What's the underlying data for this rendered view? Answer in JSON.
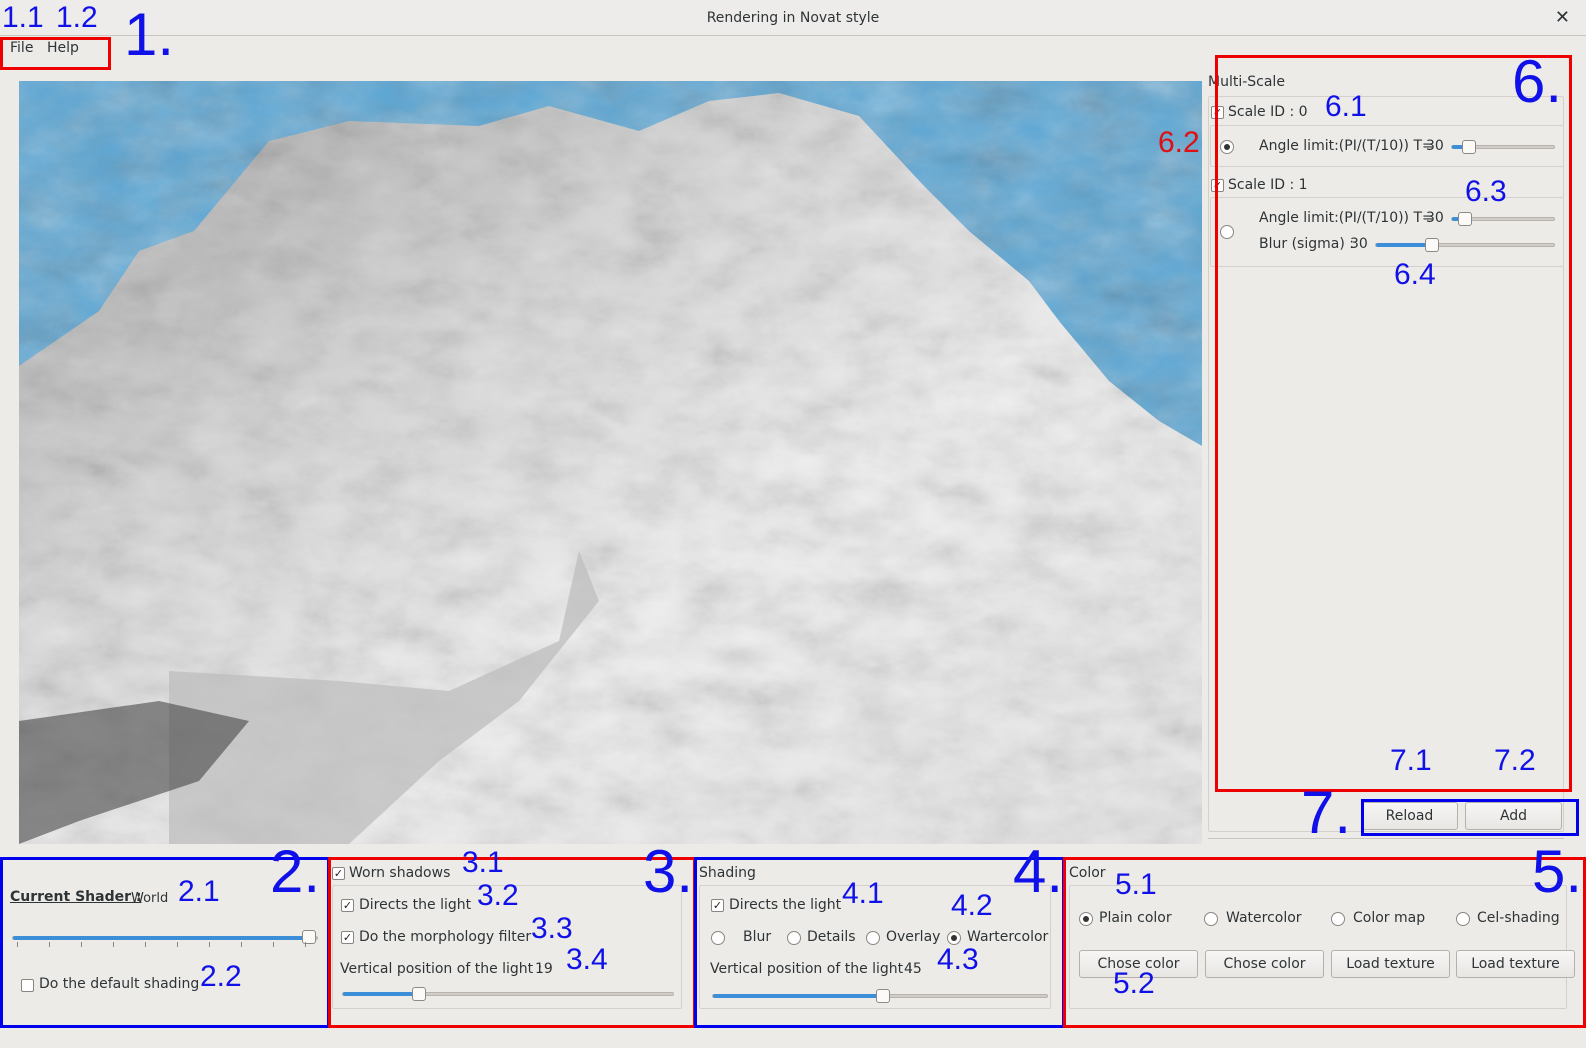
{
  "window": {
    "title": "Rendering in Novat style",
    "close": "✕"
  },
  "menu": {
    "file": "File",
    "help": "Help"
  },
  "multiscale": {
    "title": "Multi-Scale",
    "scale0": {
      "label": "Scale ID : 0",
      "checked": true,
      "angle_label": "Angle limit:(PI/(T/10)) T=",
      "angle_value": "30",
      "radio": true
    },
    "scale1": {
      "label": "Scale ID : 1",
      "checked": true,
      "angle_label": "Angle limit:(PI/(T/10)) T=",
      "angle_value": "30",
      "blur_label": "Blur (sigma) :",
      "blur_value": "30",
      "radio": false
    }
  },
  "buttons": {
    "reload": "Reload",
    "add": "Add"
  },
  "shader": {
    "label": "Current Shader :",
    "value": "World",
    "default_shading": "Do the default shading",
    "default_checked": false,
    "slider_level": 1.0
  },
  "worn": {
    "title": "Worn shadows",
    "checked": true,
    "directs": "Directs the light",
    "directs_checked": true,
    "morph": "Do the morphology filter",
    "morph_checked": true,
    "vpos_label": "Vertical position of the light :",
    "vpos_value": "19"
  },
  "shading": {
    "title": "Shading",
    "directs": "Directs the light",
    "directs_checked": true,
    "options": [
      "Blur",
      "Details",
      "Overlay",
      "Wartercolor"
    ],
    "selected": "Wartercolor",
    "vpos_label": "Vertical position of the light :",
    "vpos_value": "45"
  },
  "color": {
    "title": "Color",
    "options": [
      "Plain color",
      "Watercolor",
      "Color map",
      "Cel-shading"
    ],
    "selected": "Plain color",
    "buttons": [
      "Chose color",
      "Chose color",
      "Load texture",
      "Load texture"
    ]
  },
  "annotations": {
    "a1": "1.",
    "a11": "1.1",
    "a12": "1.2",
    "a2": "2.",
    "a21": "2.1",
    "a22": "2.2",
    "a3": "3.",
    "a31": "3.1",
    "a32": "3.2",
    "a33": "3.3",
    "a34": "3.4",
    "a4": "4.",
    "a41": "4.1",
    "a42": "4.2",
    "a43": "4.3",
    "a5": "5.",
    "a51": "5.1",
    "a52": "5.2",
    "a6": "6.",
    "a61": "6.1",
    "a62": "6.2",
    "a63": "6.3",
    "a64": "6.4",
    "a7": "7.",
    "a71": "7.1",
    "a72": "7.2"
  },
  "colors": {
    "sky": "#5aa6d5",
    "slider_fill": "#3d8ed8",
    "annotation_red": "#e01010",
    "annotation_blue": "#1010e8"
  }
}
